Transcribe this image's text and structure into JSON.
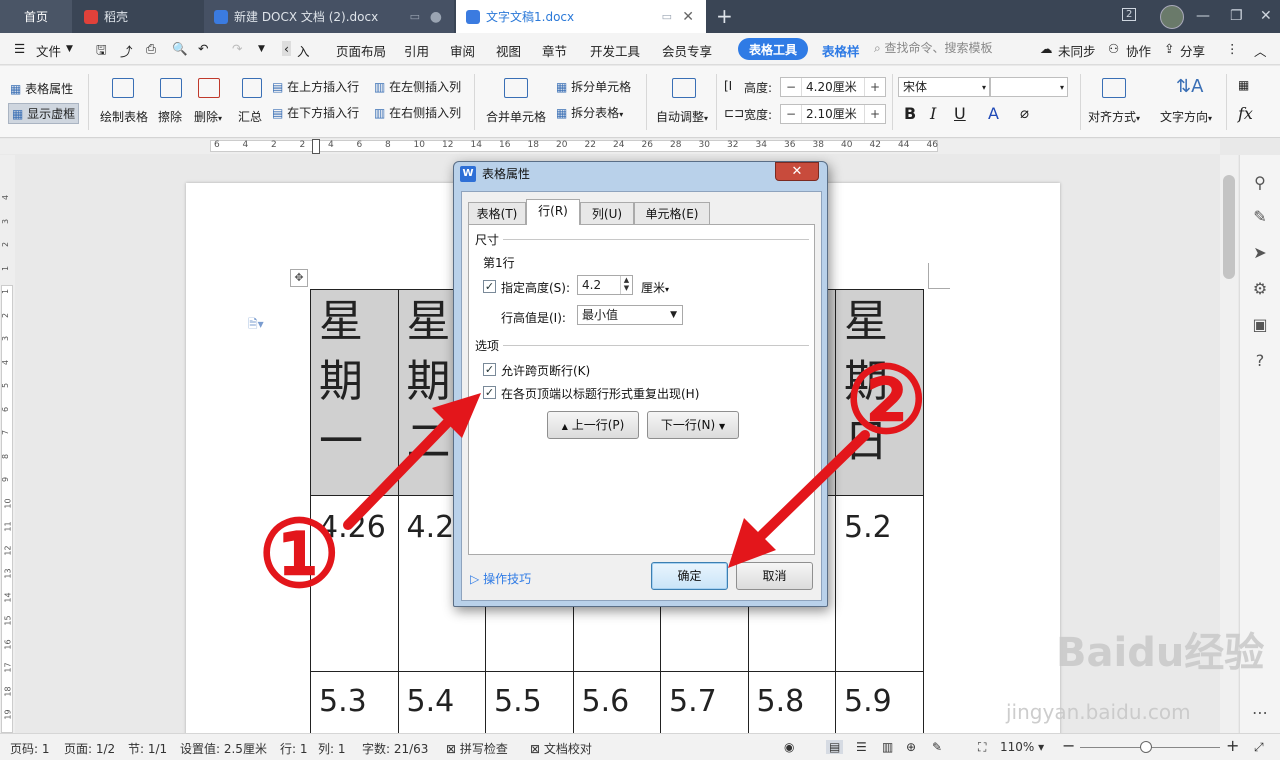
{
  "titlebar": {
    "tabs": [
      {
        "label": "首页"
      },
      {
        "label": "稻壳"
      },
      {
        "label": "新建 DOCX 文档 (2).docx"
      },
      {
        "label": "文字文稿1.docx"
      }
    ],
    "badge": "2"
  },
  "menubar": {
    "file": "文件",
    "items": [
      "入",
      "页面布局",
      "引用",
      "审阅",
      "视图",
      "章节",
      "开发工具",
      "会员专享"
    ],
    "table_tools": "表格工具",
    "table_style": "表格样",
    "search_placeholder": "查找命令、搜索模板",
    "sync": "未同步",
    "collab": "协作",
    "share": "分享"
  },
  "ribbon": {
    "table_props": "表格属性",
    "show_grid": "显示虚框",
    "draw_table": "绘制表格",
    "erase": "擦除",
    "delete": "删除",
    "summary": "汇总",
    "insert_above": "在上方插入行",
    "insert_below": "在下方插入行",
    "insert_left": "在左侧插入列",
    "insert_right": "在右侧插入列",
    "merge_cells": "合并单元格",
    "split_cells": "拆分单元格",
    "split_table": "拆分表格",
    "auto_fit": "自动调整",
    "height_label": "高度:",
    "height_value": "4.20厘米",
    "width_label": "宽度:",
    "width_value": "2.10厘米",
    "font_name": "宋体",
    "align": "对齐方式",
    "text_dir": "文字方向"
  },
  "ruler": {
    "h_ticks": [
      "6",
      "4",
      "2",
      "2",
      "4",
      "6",
      "8",
      "10",
      "12",
      "14",
      "16",
      "18",
      "20",
      "22",
      "24",
      "26",
      "28",
      "30",
      "32",
      "34",
      "36",
      "38",
      "40",
      "42",
      "44",
      "46"
    ],
    "v_ticks": [
      "4",
      "3",
      "2",
      "1",
      "1",
      "2",
      "3",
      "4",
      "5",
      "6",
      "7",
      "8",
      "9",
      "10",
      "11",
      "12",
      "13",
      "14",
      "15",
      "16",
      "17",
      "18",
      "19"
    ]
  },
  "document": {
    "header_row": [
      "星期一",
      "星期二",
      "",
      "",
      "",
      "",
      "星期日"
    ],
    "row2": [
      "4.26",
      "4.2",
      "",
      "",
      "",
      "",
      "5.2"
    ],
    "row3": [
      "5.3",
      "5.4",
      "5.5",
      "5.6",
      "5.7",
      "5.8",
      "5.9"
    ]
  },
  "dialog": {
    "title": "表格属性",
    "close": "✕",
    "tabs": [
      "表格(T)",
      "行(R)",
      "列(U)",
      "单元格(E)"
    ],
    "size_group": "尺寸",
    "row_label": "第1行",
    "specify_height": "指定高度(S):",
    "height_value": "4.2",
    "unit": "厘米",
    "row_height_is": "行高值是(I):",
    "row_height_mode": "最小值",
    "options_group": "选项",
    "allow_break": "允许跨页断行(K)",
    "repeat_header": "在各页顶端以标题行形式重复出现(H)",
    "prev_row": "上一行(P)",
    "next_row": "下一行(N)",
    "tips": "操作技巧",
    "ok": "确定",
    "cancel": "取消"
  },
  "annotations": {
    "one": "①",
    "two": "②",
    "arrow_color": "#e3161b"
  },
  "statusbar": {
    "page_num": "页码: 1",
    "pages": "页面: 1/2",
    "section": "节: 1/1",
    "setting": "设置值: 2.5厘米",
    "line": "行: 1",
    "col": "列: 1",
    "words": "字数: 21/63",
    "spell": "拼写检查",
    "proof": "文档校对",
    "zoom": "110%"
  },
  "watermark": {
    "text": "Baidu经验",
    "url_text": "jingyan.baidu.com"
  }
}
